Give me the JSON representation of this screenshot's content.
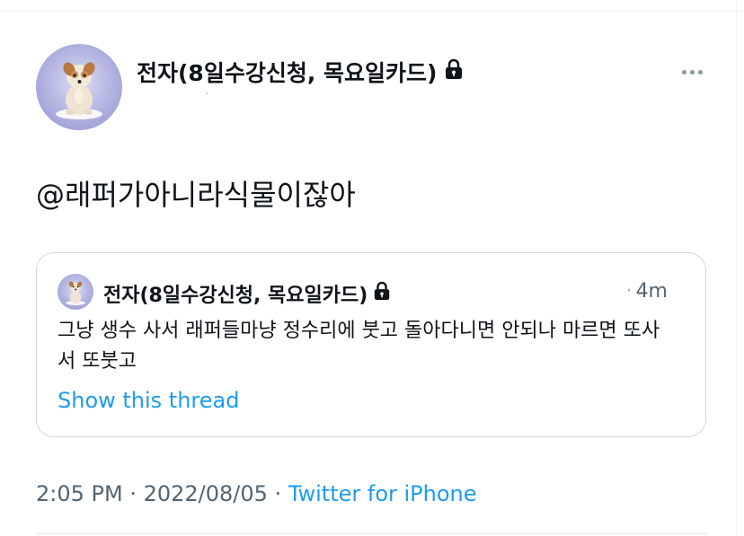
{
  "tweet": {
    "display_name": "전자(8일수강신청, 목요일카드)",
    "text": "@래퍼가아니라식물이잖아"
  },
  "icons": {
    "lock": "lock-icon",
    "more": "more-horizontal-icon",
    "avatar": "dog-avatar"
  },
  "quote": {
    "display_name": "전자(8일수강신청, 목요일카드)",
    "separator": "·",
    "time": "4m",
    "text": "그냥 생수 사서 래퍼들마냥 정수리에 붓고 돌아다니면 안되나 마르면 또사서 또붓고",
    "show_thread": "Show this thread"
  },
  "footer": {
    "time": "2:05 PM",
    "sep1": " · ",
    "date": "2022/08/05",
    "sep2": " · ",
    "source": "Twitter for iPhone"
  },
  "colors": {
    "link": "#1d9bf0",
    "muted": "#536471",
    "border": "#cfd9de"
  }
}
